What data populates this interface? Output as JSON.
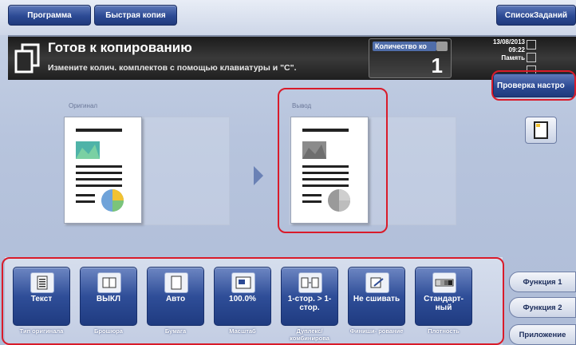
{
  "topbar": {
    "program_label": "Программа",
    "quick_copy_label": "Быстрая копия",
    "joblist_label": "СписокЗаданий"
  },
  "status": {
    "title": "Готов к копированию",
    "subtitle": "Измените колич. комплектов с помощью клавиатуры и \"C\".",
    "count_label": "Количество ко",
    "count_value": "1",
    "date": "13/08/2013",
    "time": "09:22",
    "memory_label": "Память"
  },
  "check_settings_label": "Проверка настро",
  "preview": {
    "original_label": "Оригинал",
    "output_label": "Вывод"
  },
  "functions": [
    {
      "icon": "text-document-icon",
      "value": "Текст",
      "caption": "Тип оригинала"
    },
    {
      "icon": "booklet-icon",
      "value": "ВЫКЛ",
      "caption": "Брошюра"
    },
    {
      "icon": "paper-icon",
      "value": "Авто",
      "caption": "Бумага"
    },
    {
      "icon": "zoom-icon",
      "value": "100.0%",
      "caption": "Масштаб"
    },
    {
      "icon": "duplex-icon",
      "value": "1-стор. > 1-стор.",
      "caption": "Дуплекс/ комбинирова"
    },
    {
      "icon": "staple-icon",
      "value": "Не сшивать",
      "caption": "Финиши- рование"
    },
    {
      "icon": "density-icon",
      "value": "Стандарт- ный",
      "caption": "Плотность"
    }
  ],
  "side_tabs": {
    "function1": "Функция 1",
    "function2": "Функция 2",
    "application": "Приложение"
  },
  "colors": {
    "button_blue": "#2c4a94",
    "highlight_red": "#d91b2a"
  }
}
